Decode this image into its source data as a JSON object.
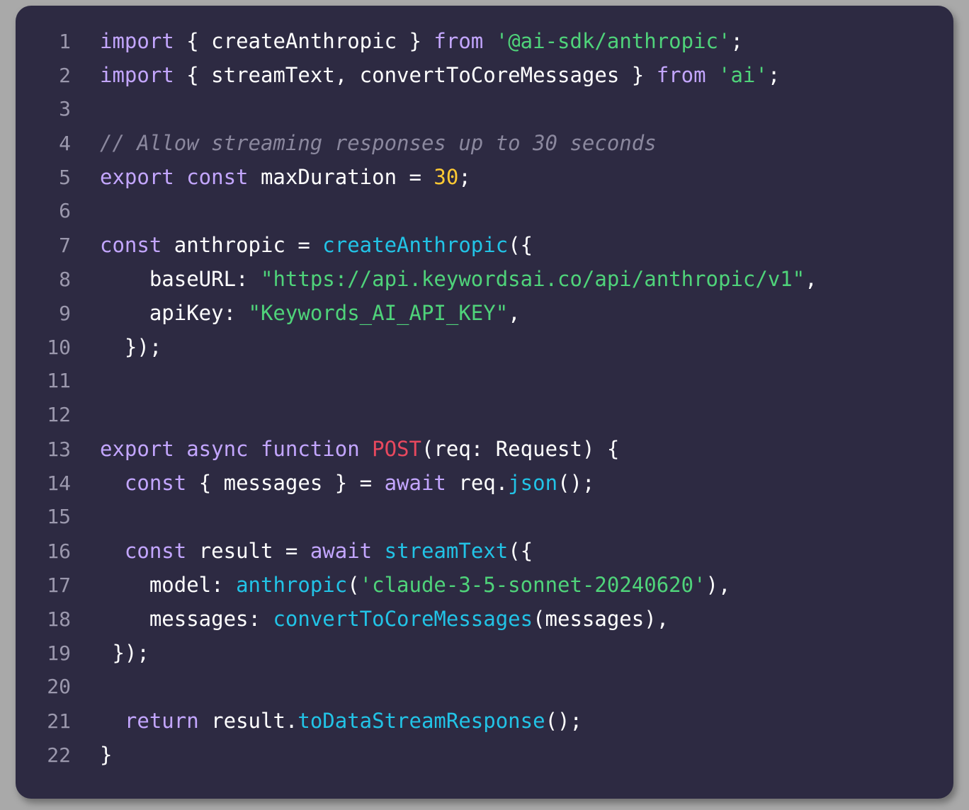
{
  "editor": {
    "background_color": "#2d2a42",
    "outer_background_color": "#a9a9a9",
    "language": "typescript",
    "total_lines": 22
  },
  "theme": {
    "keyword_color": "#c3a6ff",
    "string_color": "#4fd37a",
    "function_color": "#22c3e6",
    "number_color": "#ffc933",
    "declaration_color": "#e8485e",
    "plain_color": "#ffffff",
    "comment_color": "#8b889e",
    "line_number_color": "#9b98ad"
  },
  "lines": [
    {
      "number": "1",
      "tokens": [
        {
          "t": "import",
          "c": "kw"
        },
        {
          "t": " { createAnthropic } ",
          "c": "plain"
        },
        {
          "t": "from",
          "c": "kw"
        },
        {
          "t": " ",
          "c": "plain"
        },
        {
          "t": "'@ai-sdk/anthropic'",
          "c": "str"
        },
        {
          "t": ";",
          "c": "plain"
        }
      ]
    },
    {
      "number": "2",
      "tokens": [
        {
          "t": "import",
          "c": "kw"
        },
        {
          "t": " { streamText, convertToCoreMessages } ",
          "c": "plain"
        },
        {
          "t": "from",
          "c": "kw"
        },
        {
          "t": " ",
          "c": "plain"
        },
        {
          "t": "'ai'",
          "c": "str"
        },
        {
          "t": ";",
          "c": "plain"
        }
      ]
    },
    {
      "number": "3",
      "tokens": []
    },
    {
      "number": "4",
      "tokens": [
        {
          "t": "// Allow streaming responses up to 30 seconds",
          "c": "com"
        }
      ]
    },
    {
      "number": "5",
      "tokens": [
        {
          "t": "export const",
          "c": "kw"
        },
        {
          "t": " maxDuration = ",
          "c": "plain"
        },
        {
          "t": "30",
          "c": "num"
        },
        {
          "t": ";",
          "c": "plain"
        }
      ]
    },
    {
      "number": "6",
      "tokens": []
    },
    {
      "number": "7",
      "tokens": [
        {
          "t": "const",
          "c": "kw"
        },
        {
          "t": " anthropic = ",
          "c": "plain"
        },
        {
          "t": "createAnthropic",
          "c": "fn"
        },
        {
          "t": "({",
          "c": "plain"
        }
      ]
    },
    {
      "number": "8",
      "tokens": [
        {
          "t": "    baseURL: ",
          "c": "plain"
        },
        {
          "t": "\"https://api.keywordsai.co/api/anthropic/v1\"",
          "c": "str"
        },
        {
          "t": ",",
          "c": "plain"
        }
      ]
    },
    {
      "number": "9",
      "tokens": [
        {
          "t": "    apiKey: ",
          "c": "plain"
        },
        {
          "t": "\"Keywords_AI_API_KEY\"",
          "c": "str"
        },
        {
          "t": ",",
          "c": "plain"
        }
      ]
    },
    {
      "number": "10",
      "tokens": [
        {
          "t": "  });",
          "c": "plain"
        }
      ]
    },
    {
      "number": "11",
      "tokens": []
    },
    {
      "number": "12",
      "tokens": []
    },
    {
      "number": "13",
      "tokens": [
        {
          "t": "export async function",
          "c": "kw"
        },
        {
          "t": " ",
          "c": "plain"
        },
        {
          "t": "POST",
          "c": "post"
        },
        {
          "t": "(req: Request) {",
          "c": "plain"
        }
      ]
    },
    {
      "number": "14",
      "tokens": [
        {
          "t": "  ",
          "c": "plain"
        },
        {
          "t": "const",
          "c": "kw"
        },
        {
          "t": " { messages } = ",
          "c": "plain"
        },
        {
          "t": "await",
          "c": "kw"
        },
        {
          "t": " req.",
          "c": "plain"
        },
        {
          "t": "json",
          "c": "fn"
        },
        {
          "t": "();",
          "c": "plain"
        }
      ]
    },
    {
      "number": "15",
      "tokens": []
    },
    {
      "number": "16",
      "tokens": [
        {
          "t": "  ",
          "c": "plain"
        },
        {
          "t": "const",
          "c": "kw"
        },
        {
          "t": " result = ",
          "c": "plain"
        },
        {
          "t": "await",
          "c": "kw"
        },
        {
          "t": " ",
          "c": "plain"
        },
        {
          "t": "streamText",
          "c": "fn"
        },
        {
          "t": "({",
          "c": "plain"
        }
      ]
    },
    {
      "number": "17",
      "tokens": [
        {
          "t": "    model: ",
          "c": "plain"
        },
        {
          "t": "anthropic",
          "c": "fn"
        },
        {
          "t": "(",
          "c": "plain"
        },
        {
          "t": "'claude-3-5-sonnet-20240620'",
          "c": "str"
        },
        {
          "t": "),",
          "c": "plain"
        }
      ]
    },
    {
      "number": "18",
      "tokens": [
        {
          "t": "    messages: ",
          "c": "plain"
        },
        {
          "t": "convertToCoreMessages",
          "c": "fn"
        },
        {
          "t": "(messages),",
          "c": "plain"
        }
      ]
    },
    {
      "number": "19",
      "tokens": [
        {
          "t": " });",
          "c": "plain"
        }
      ]
    },
    {
      "number": "20",
      "tokens": []
    },
    {
      "number": "21",
      "tokens": [
        {
          "t": "  ",
          "c": "plain"
        },
        {
          "t": "return",
          "c": "kw"
        },
        {
          "t": " result.",
          "c": "plain"
        },
        {
          "t": "toDataStreamResponse",
          "c": "fn"
        },
        {
          "t": "();",
          "c": "plain"
        }
      ]
    },
    {
      "number": "22",
      "tokens": [
        {
          "t": "}",
          "c": "plain"
        }
      ]
    }
  ]
}
